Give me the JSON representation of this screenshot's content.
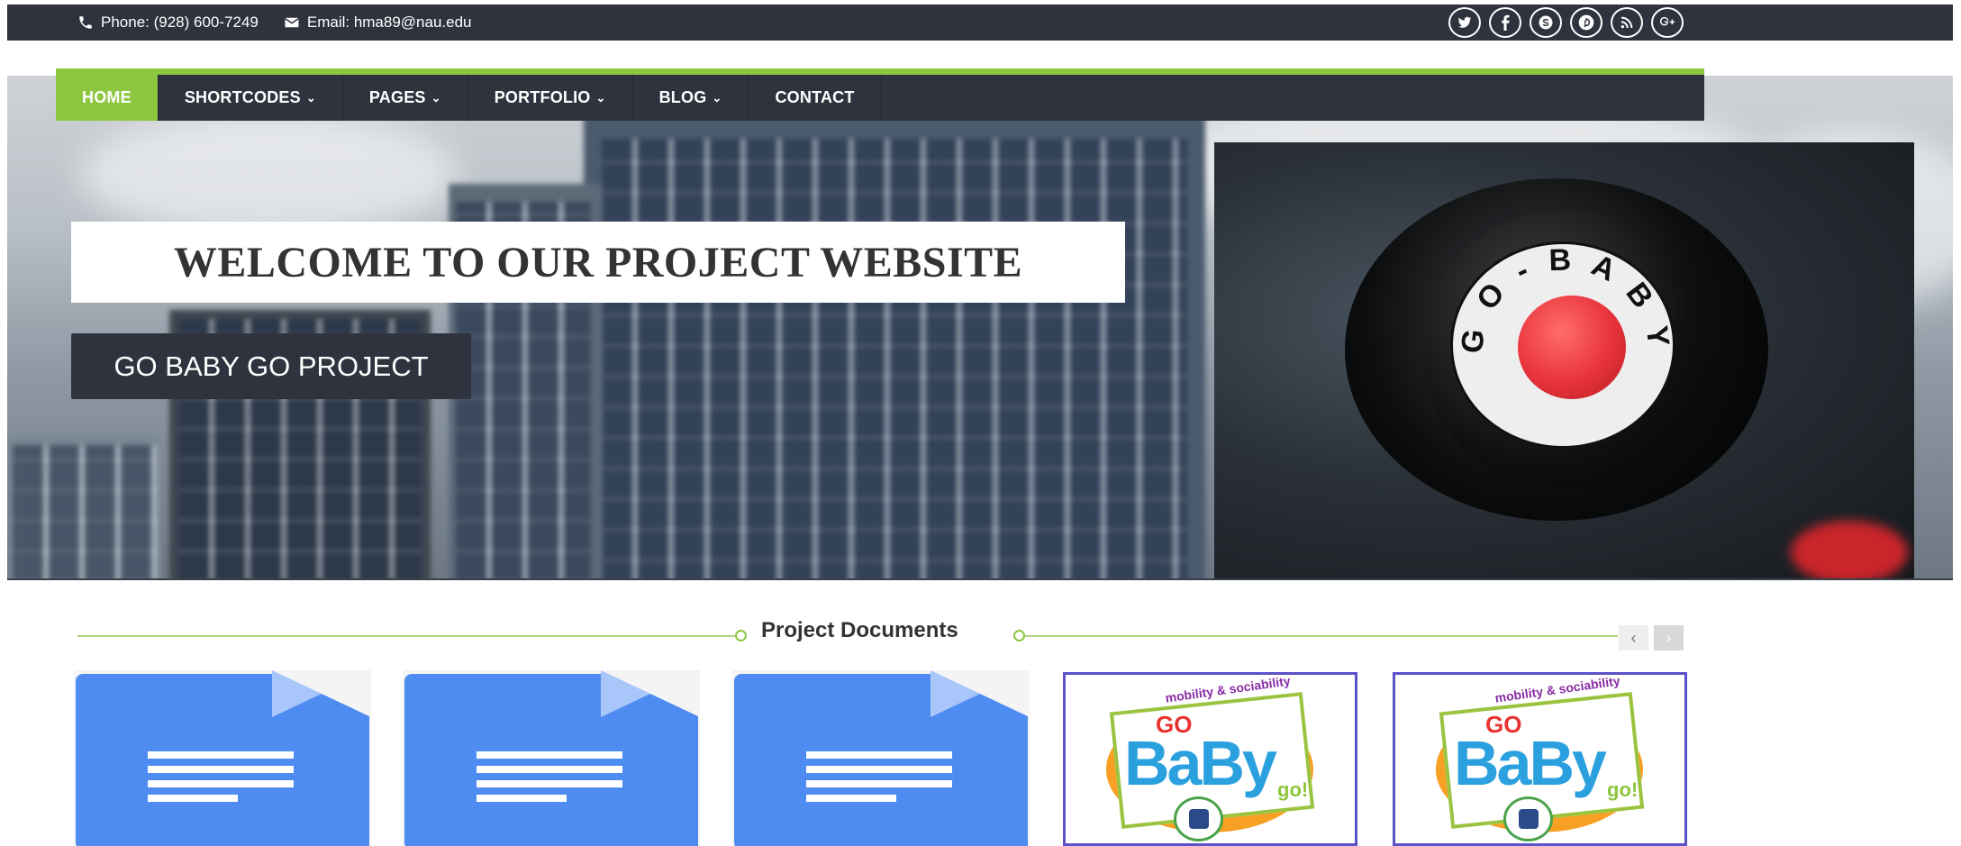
{
  "topbar": {
    "phone": "Phone: (928) 600-7249",
    "email": "Email: hma89@nau.edu",
    "socials": [
      "twitter-icon",
      "facebook-icon",
      "skype-icon",
      "pinterest-icon",
      "rss-icon",
      "google-plus-icon"
    ]
  },
  "nav": {
    "items": [
      {
        "label": "HOME",
        "active": true
      },
      {
        "label": "SHORTCODES",
        "dropdown": true
      },
      {
        "label": "PAGES",
        "dropdown": true
      },
      {
        "label": "PORTFOLIO",
        "dropdown": true
      },
      {
        "label": "BLOG",
        "dropdown": true
      },
      {
        "label": "CONTACT"
      }
    ],
    "chevron": "⌄"
  },
  "hero": {
    "welcome": "WELCOME TO OUR PROJECT WEBSITE",
    "cta": "GO BABY GO PROJECT"
  },
  "documents": {
    "title": "Project Documents",
    "prev": "‹",
    "next": "›",
    "items": [
      {
        "kind": "google-doc-icon"
      },
      {
        "kind": "google-doc-icon"
      },
      {
        "kind": "google-doc-icon"
      },
      {
        "kind": "go-baby-go-logo",
        "tag": "mobility & sociability",
        "go": "GO",
        "baby": "BaBy",
        "go2": "go!"
      },
      {
        "kind": "go-baby-go-logo",
        "tag": "mobility & sociability",
        "go": "GO",
        "baby": "BaBy",
        "go2": "go!"
      }
    ]
  },
  "colors": {
    "accent": "#8dc63f",
    "dark": "#2f333e",
    "doc_blue": "#4f8cf1"
  }
}
